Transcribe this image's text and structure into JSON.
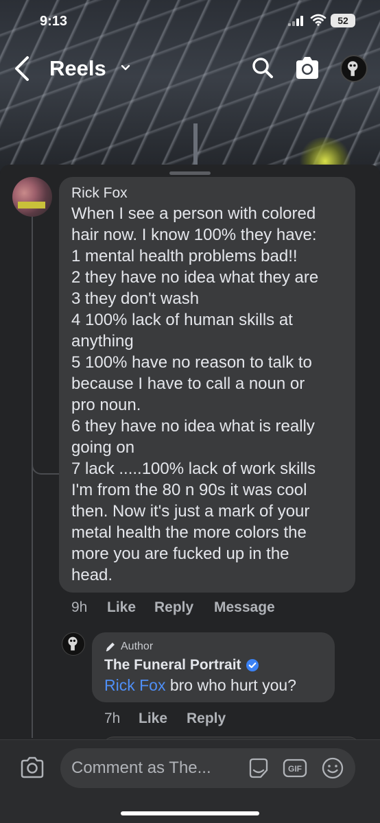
{
  "status_bar": {
    "time": "9:13",
    "battery": "52"
  },
  "header": {
    "title": "Reels"
  },
  "comment": {
    "author": "Rick Fox",
    "lines": [
      "When I see a person with colored",
      "hair now. I know 100% they have:",
      "1 mental health problems bad!!",
      "2 they have no idea what they are",
      "3 they don't wash",
      "4 100% lack of human skills at",
      "anything",
      "5 100% have no reason to talk to",
      "because I have to call a noun or",
      "pro noun.",
      "6 they have no idea what is really",
      "going on",
      "7 lack .....100% lack of work skills",
      "I'm from the 80 n 90s it was cool",
      "then. Now it's just a mark of your",
      "metal health the more colors the",
      "more you are fucked up in the",
      "head."
    ],
    "time": "9h",
    "like_label": "Like",
    "reply_label": "Reply",
    "message_label": "Message"
  },
  "reply": {
    "badge": "Author",
    "author": "The Funeral Portrait",
    "mention": "Rick Fox",
    "text": " bro who hurt you?",
    "time": "7h",
    "like_label": "Like",
    "reply_label": "Reply"
  },
  "composer": {
    "placeholder": "Comment as The..."
  },
  "colors": {
    "background": "#232426",
    "bubble": "#3a3b3d",
    "mention": "#4f8ff7",
    "verified": "#3b82f6"
  },
  "icons": [
    "back-icon",
    "chevron-down-icon",
    "search-icon",
    "camera-icon",
    "pencil-icon",
    "verified-icon",
    "sticker-icon",
    "gif-icon",
    "emoji-icon"
  ]
}
